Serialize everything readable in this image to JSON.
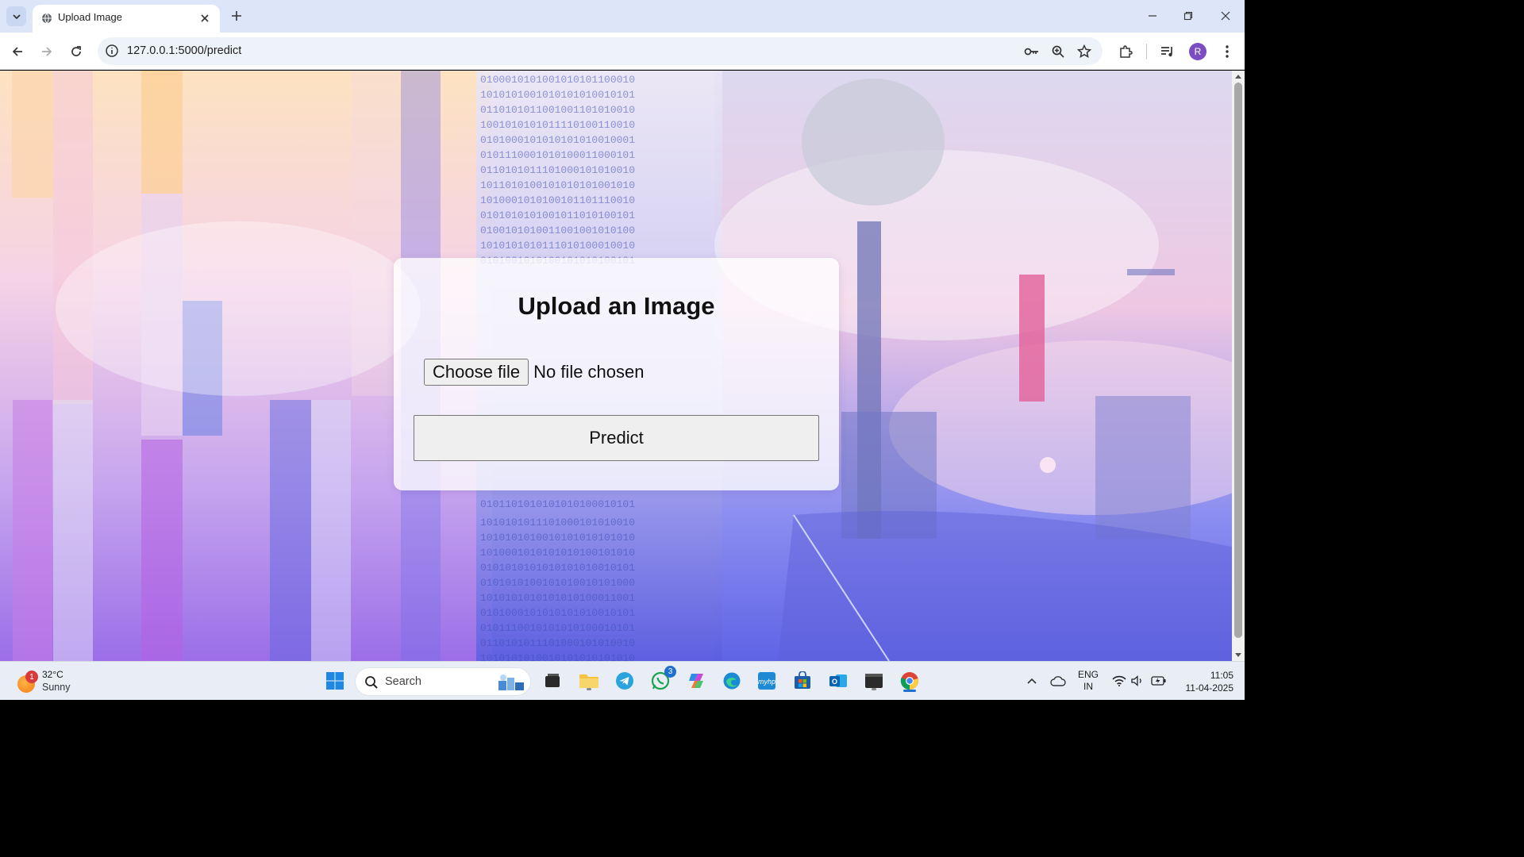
{
  "browser": {
    "tab_title": "Upload Image",
    "url": "127.0.0.1:5000/predict",
    "profile_initial": "R"
  },
  "page": {
    "heading": "Upload an Image",
    "choose_file_label": "Choose file",
    "file_status": "No file chosen",
    "predict_label": "Predict"
  },
  "taskbar": {
    "weather_temp": "32°C",
    "weather_condition": "Sunny",
    "weather_badge": "1",
    "search_placeholder": "Search",
    "whatsapp_badge": "3",
    "language": "ENG",
    "region": "IN",
    "time": "11:05",
    "date": "11-04-2025"
  },
  "colors": {
    "accent": "#1f6fd1",
    "profile": "#7b4cc2",
    "card_bg": "#ffffff"
  }
}
